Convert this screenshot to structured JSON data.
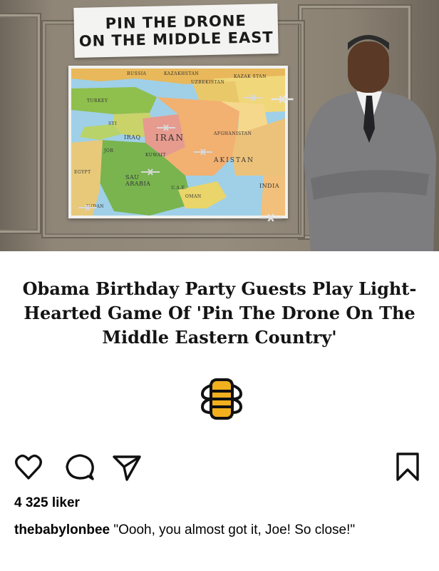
{
  "post": {
    "image": {
      "sign_line1": "PIN THE DRONE",
      "sign_line2": "ON THE MIDDLE EAST",
      "map_labels": {
        "russia": "RUSSIA",
        "kazakhstan_top": "KAZAKHSTAN",
        "kazakhstan": "KAZAK STAN",
        "uzbekistan": "UZBEKISTAN",
        "turkey": "TURKEY",
        "syria": "SYI",
        "iraq": "IRAQ",
        "iran": "IRAN",
        "afghanistan": "AFGHANISTAN",
        "jordan": "JOR",
        "kuwait": "KUWAIT",
        "pakistan": "AKISTAN",
        "egypt": "EGYPT",
        "saudi": "SAU ARABIA",
        "uae": "U.A.E.",
        "oman": "OMAN",
        "india": "INDIA",
        "sudan": "SUDAN"
      }
    },
    "headline": "Obama Birthday Party Guests Play Light-Hearted Game Of 'Pin The Drone On The Middle Eastern Country'",
    "likes": "4 325 liker",
    "caption_user": "thebabylonbee",
    "caption_text": " \"Oooh, you almost got it, Joe! So close!\""
  },
  "icons": {
    "like": "heart-icon",
    "comment": "comment-icon",
    "share": "send-icon",
    "save": "bookmark-icon",
    "logo": "babylon-bee-logo"
  },
  "colors": {
    "wall": "#8f8678",
    "map_water": "#9fd0e8",
    "headline": "#141414"
  }
}
